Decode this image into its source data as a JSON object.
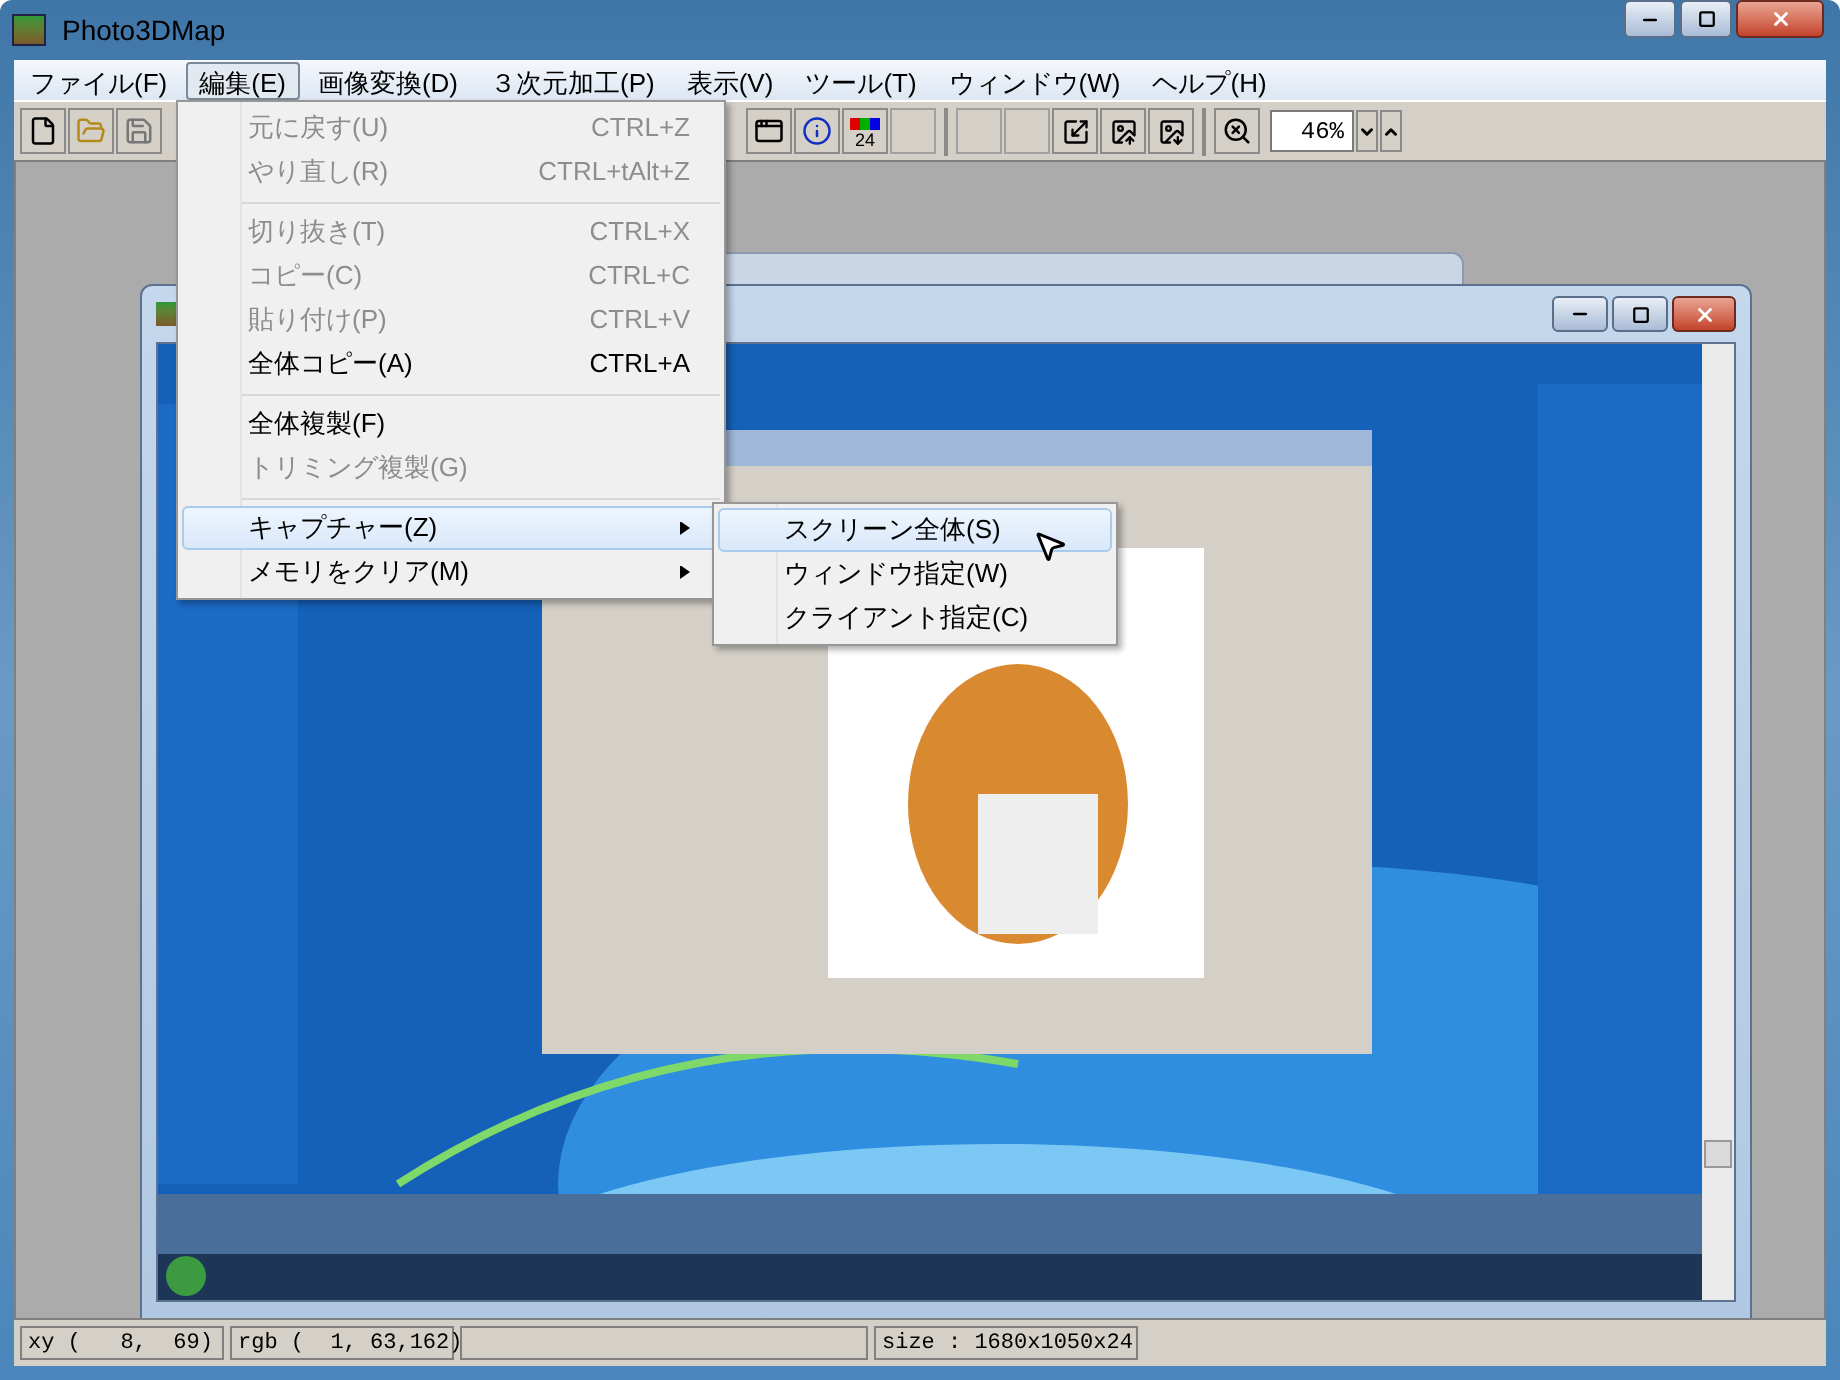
{
  "window": {
    "title": "Photo3DMap"
  },
  "menu_bar": [
    {
      "label": "ファイル(F)",
      "selected": false
    },
    {
      "label": "編集(E)",
      "selected": true
    },
    {
      "label": "画像変換(D)",
      "selected": false
    },
    {
      "label": "３次元加工(P)",
      "selected": false
    },
    {
      "label": "表示(V)",
      "selected": false
    },
    {
      "label": "ツール(T)",
      "selected": false
    },
    {
      "label": "ウィンドウ(W)",
      "selected": false
    },
    {
      "label": "ヘルプ(H)",
      "selected": false
    }
  ],
  "toolbar": {
    "color_depth_label": "24",
    "zoom_value": "46%"
  },
  "edit_menu": [
    {
      "kind": "item",
      "label": "元に戻す(U)",
      "shortcut": "CTRL+Z",
      "disabled": true,
      "selected": false
    },
    {
      "kind": "item",
      "label": "やり直し(R)",
      "shortcut": "CTRL+tAlt+Z",
      "disabled": true,
      "selected": false
    },
    {
      "kind": "separator"
    },
    {
      "kind": "item",
      "label": "切り抜き(T)",
      "shortcut": "CTRL+X",
      "disabled": true,
      "selected": false
    },
    {
      "kind": "item",
      "label": "コピー(C)",
      "shortcut": "CTRL+C",
      "disabled": true,
      "selected": false
    },
    {
      "kind": "item",
      "label": "貼り付け(P)",
      "shortcut": "CTRL+V",
      "disabled": true,
      "selected": false
    },
    {
      "kind": "item",
      "label": "全体コピー(A)",
      "shortcut": "CTRL+A",
      "disabled": false,
      "selected": false
    },
    {
      "kind": "separator"
    },
    {
      "kind": "item",
      "label": "全体複製(F)",
      "disabled": false,
      "selected": false
    },
    {
      "kind": "item",
      "label": "トリミング複製(G)",
      "disabled": true,
      "selected": false
    },
    {
      "kind": "separator"
    },
    {
      "kind": "submenu",
      "label": "キャプチャー(Z)",
      "disabled": false,
      "selected": true
    },
    {
      "kind": "submenu",
      "label": "メモリをクリア(M)",
      "disabled": false,
      "selected": false
    }
  ],
  "capture_submenu": [
    {
      "label": "スクリーン全体(S)",
      "selected": true
    },
    {
      "label": "ウィンドウ指定(W)",
      "selected": false
    },
    {
      "label": "クライアント指定(C)",
      "selected": false
    }
  ],
  "status_bar": {
    "xy": "xy (   8,  69)",
    "rgb": "rgb (  1, 63,162)",
    "size": "size : 1680x1050x24"
  }
}
